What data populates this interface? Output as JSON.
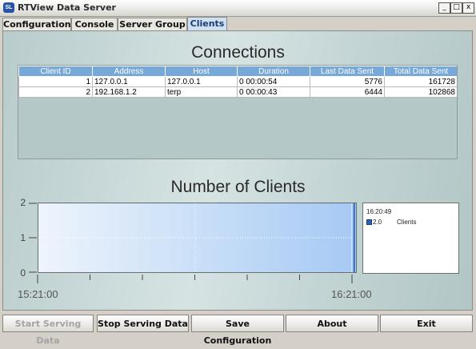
{
  "window": {
    "icon_text": "SL",
    "title": "RTView Data Server",
    "minimize_glyph": "_",
    "maximize_glyph": "□",
    "close_glyph": "x"
  },
  "tabs": [
    {
      "label": "Configuration",
      "active": false
    },
    {
      "label": "Console",
      "active": false
    },
    {
      "label": "Server Group",
      "active": false
    },
    {
      "label": "Clients",
      "active": true
    }
  ],
  "connections": {
    "title": "Connections",
    "columns": [
      "Client ID",
      "Address",
      "Host",
      "Duration",
      "Last Data Sent",
      "Total Data Sent"
    ],
    "rows": [
      [
        "1",
        "127.0.0.1",
        "127.0.0.1",
        "0 00:00:54",
        "5776",
        "161728"
      ],
      [
        "2",
        "192.168.1.2",
        "terp",
        "0 00:00:43",
        "6444",
        "102868"
      ]
    ]
  },
  "chart_data": {
    "type": "area",
    "title": "Number of Clients",
    "xlabel": "",
    "ylabel": "",
    "x_ticks": [
      "15:21:00",
      "16:21:00"
    ],
    "y_ticks": [
      0,
      1,
      2
    ],
    "ylim": [
      0,
      2
    ],
    "series": [
      {
        "name": "Clients",
        "color": "#2a64b8",
        "fill": "#a6c9f4",
        "x": [
          "15:21:00",
          "16:20:49"
        ],
        "values": [
          2.0,
          2.0
        ]
      }
    ],
    "grid": true,
    "legend": {
      "placement": "right",
      "time": "16:20:49",
      "value": "2.0",
      "label": "Clients"
    }
  },
  "buttons": [
    {
      "label": "Start Serving Data",
      "enabled": false
    },
    {
      "label": "Stop Serving Data",
      "enabled": true
    },
    {
      "label": "Save Configuration",
      "enabled": true
    },
    {
      "label": "About",
      "enabled": true
    },
    {
      "label": "Exit",
      "enabled": true
    }
  ],
  "colors": {
    "tab_active": "#cfe0f0",
    "table_header": "#76a9d8",
    "plot_fill": "#a6c9f4",
    "series_line": "#2a64b8"
  }
}
